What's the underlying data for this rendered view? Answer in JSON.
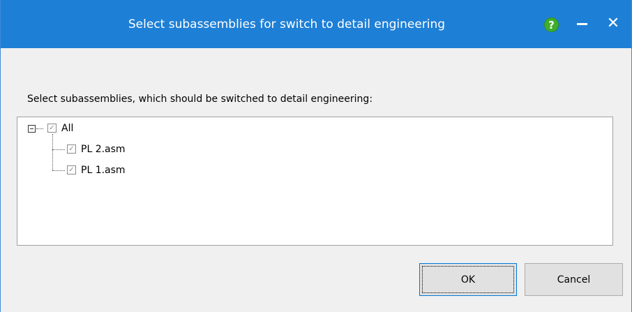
{
  "dialog": {
    "title": "Select subassemblies for switch to detail engineering",
    "prompt": "Select subassemblies, which should be switched to detail engineering:",
    "help_icon": "question-icon",
    "help_glyph": "?",
    "close_glyph": "✕",
    "accent": "#1e7fd6"
  },
  "tree": {
    "root": {
      "label": "All",
      "checked": true,
      "expanded": true
    },
    "children": [
      {
        "label": "PL 2.asm",
        "checked": true
      },
      {
        "label": "PL 1.asm",
        "checked": true
      }
    ]
  },
  "buttons": {
    "ok": "OK",
    "cancel": "Cancel"
  }
}
